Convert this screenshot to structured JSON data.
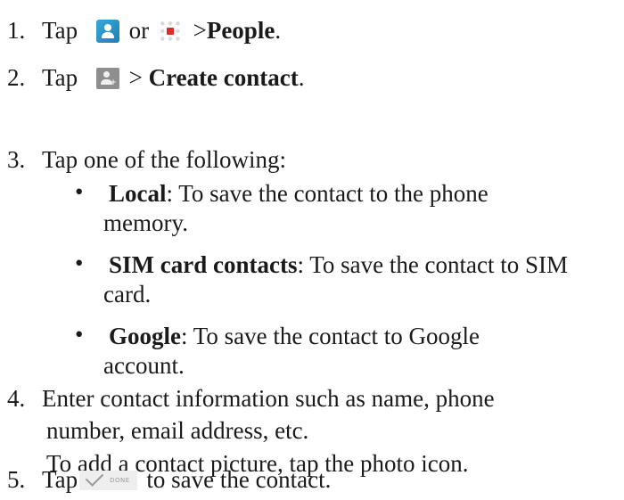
{
  "steps": {
    "s1": {
      "num": "1.",
      "pre": "Tap",
      "mid": "or",
      "sep": ">",
      "bold": "People",
      "post": "."
    },
    "s2": {
      "num": "2.",
      "pre": "Tap",
      "sep": ">",
      "bold": "Create contact",
      "post": "."
    },
    "s3": {
      "num": "3.",
      "text": "Tap one of the following:",
      "bullets": [
        {
          "bold": "Local",
          "rest1": ": To save the contact to the phone",
          "rest2": "memory."
        },
        {
          "bold": "SIM card contacts",
          "rest1": ": To save the contact to SIM",
          "rest2": "card."
        },
        {
          "bold": "Google",
          "rest1": ": To save the contact to Google",
          "rest2": "account."
        }
      ]
    },
    "s4": {
      "num": "4.",
      "line1": "Enter contact information such as name, phone",
      "line2": "number, email address, etc.",
      "line3": "To add a contact picture, tap the photo icon."
    },
    "s5": {
      "num": "5.",
      "pre": "Tap",
      "done_label": "DONE",
      "post": "to save the contact."
    }
  },
  "icons": {
    "people": "people-app-icon",
    "apps": "apps-grid-icon",
    "add_contact": "add-contact-icon",
    "done": "done-check-icon"
  }
}
